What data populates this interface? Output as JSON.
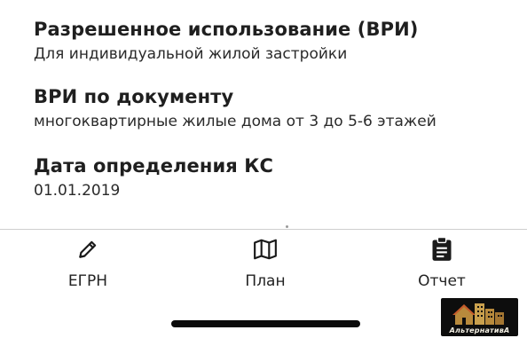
{
  "details": {
    "permitted_use": {
      "label": "Разрешенное использование (ВРИ)",
      "value": "Для индивидуальной жилой застройки"
    },
    "document_use": {
      "label": "ВРИ по документу",
      "value": "многоквартирные жилые дома от 3 до 5-6 этажей"
    },
    "cadastral_date": {
      "label": "Дата определения КС",
      "value": "01.01.2019"
    }
  },
  "tabbar": {
    "items": [
      {
        "label": "ЕГРН",
        "icon": "pencil-icon"
      },
      {
        "label": "План",
        "icon": "map-icon"
      },
      {
        "label": "Отчет",
        "icon": "clipboard-icon"
      }
    ]
  },
  "watermark": {
    "text": "АльтернативА",
    "colors": {
      "roof": "#c45a2a",
      "building": "#b88a3c"
    }
  }
}
